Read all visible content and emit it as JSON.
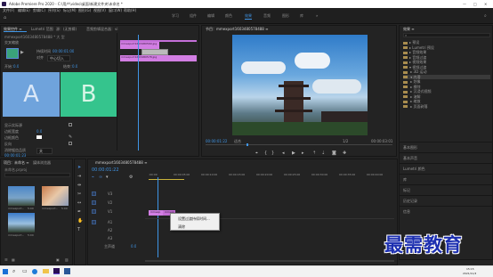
{
  "window": {
    "title": "Adobe Premiere Pro 2020 - C:\\用户\\video\\桌面\\新建文件夹\\未命名 *"
  },
  "menu": [
    "文件(F)",
    "编辑(E)",
    "剪辑(C)",
    "序列(S)",
    "标记(M)",
    "图形(G)",
    "视图(V)",
    "窗口(W)",
    "帮助(H)"
  ],
  "workspaces": [
    "学习",
    "组件",
    "编辑",
    "颜色",
    "效果",
    "音频",
    "图形",
    "库"
  ],
  "active_workspace": "效果",
  "effect_controls": {
    "tabs": [
      "效果控件 ≡",
      "Lumetri 范围",
      "源：(无剪辑)",
      "音频剪辑混合器：vi"
    ],
    "sequence": "mmexport1603480578488 * 大 型",
    "clip_name": "mmexport1603480578489.jpg",
    "transition_name": "交叉缩放",
    "section_header": "视频效果 ▸",
    "labels": [
      "持续时间",
      "对齐",
      "开始：",
      "结束："
    ],
    "duration": "00:00:01:00",
    "align": "中心切入",
    "start_value": "0.0",
    "end_value": "0.0",
    "letter_a": "A",
    "letter_b": "B",
    "options": [
      "显示实际源",
      "边框宽度",
      "边框颜色",
      "反向",
      "消除锯齿品质"
    ],
    "border_value": "0.0",
    "aa_value": "关",
    "timecode": "00:00:01:23",
    "mini_clips": [
      "mmexport1603480569.jpg",
      "mmexport1603480578.jpg"
    ]
  },
  "program": {
    "tab": "节目：mmexport1603480578488 ≡",
    "timecode": "00:00:01:22",
    "fit": "适合",
    "ratio": "1/2",
    "duration": "00:00:03:01",
    "control_icons": [
      "marker-icon",
      "in-point-icon",
      "out-point-icon",
      "step-back-icon",
      "play-icon",
      "step-forward-icon",
      "lift-icon",
      "extract-icon",
      "export-frame-icon",
      "settings-icon"
    ]
  },
  "effects": {
    "tab": "效果 ≡",
    "tree": [
      "▸ 预设",
      "▸ Lumetri 预设",
      "▸ 音频效果",
      "▸ 音频过渡",
      "▸ 视频效果",
      "▾ 视频过渡",
      "   ▸ 3D 运动",
      "   ▾ 内滑",
      "   ▸ 划像",
      "   ▸ 擦除",
      "   ▸ 沉浸式视频",
      "   ▸ 溶解",
      "   ▸ 缩放",
      "   ▸ 页面剥落"
    ],
    "lower": [
      "基本图形",
      "基本声音",
      "Lumetri 颜色",
      "库",
      "标记",
      "历史记录",
      "信息"
    ]
  },
  "project": {
    "tabs": [
      "项目：未命名 ≡",
      "媒体浏览器"
    ],
    "file": "未命名.prproj",
    "items": [
      "mmexport...",
      "mmexport...",
      "mmexport..."
    ],
    "durations": [
      "5:00",
      "5:00",
      "5:00"
    ]
  },
  "timeline": {
    "tab": "mmexport1603480578488 ≡",
    "timecode": "00:00:01:22",
    "ruler": [
      ":00:00",
      "00:00:05:00",
      "00:00:10:00",
      "00:00:15:00",
      "00:00:20:00",
      "00:00:25:00",
      "00:00:30:00",
      "00:00:35:00",
      "00:00:40:00"
    ],
    "tracks": [
      "V3",
      "V2",
      "V1",
      "A1",
      "A2",
      "A3",
      "主声道"
    ],
    "master_value": "0.0",
    "clip_a": "mmexp",
    "clip_b": "mmexp",
    "context_menu": [
      "设置过渡持续时间...",
      "清除"
    ]
  },
  "taskbar": {
    "time": "15:15",
    "date": "2021/11/4"
  },
  "watermark": "最需教育",
  "colors": {
    "accent": "#3f95e6",
    "clip": "#d27ee3",
    "slot_a": "#6fa3dc",
    "slot_b": "#35c48d",
    "watermark": "#1c2fb0"
  }
}
